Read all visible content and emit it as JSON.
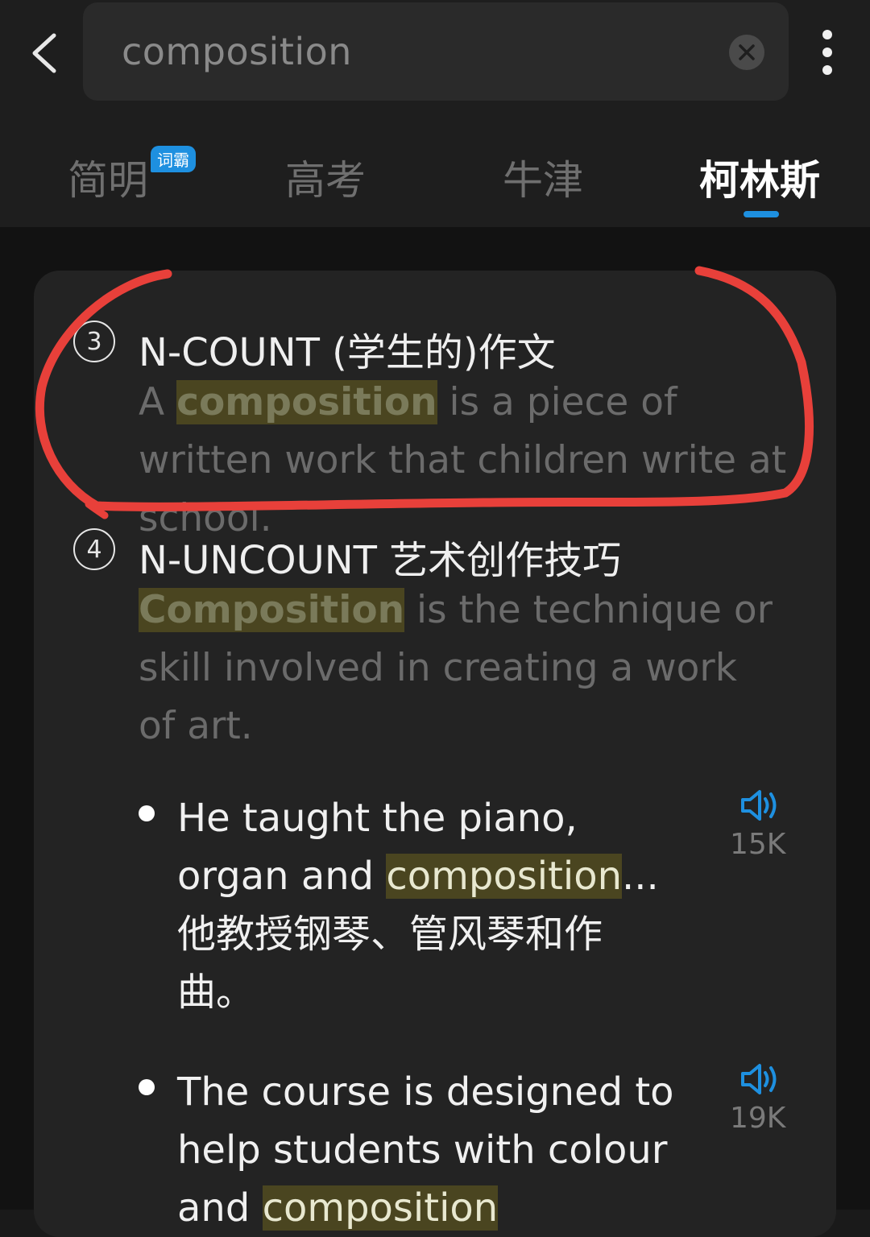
{
  "search": {
    "query": "composition"
  },
  "tabs": [
    {
      "label": "简明",
      "badge": "词霸"
    },
    {
      "label": "高考"
    },
    {
      "label": "牛津"
    },
    {
      "label": "柯林斯"
    }
  ],
  "senses": [
    {
      "number": "3",
      "head": "N-COUNT (学生的)作文",
      "def_pre": "A ",
      "def_hl": "composition",
      "def_post": " is a piece of written work that children write at school."
    },
    {
      "number": "4",
      "head": "N-UNCOUNT 艺术创作技巧",
      "def_hl": "Composition",
      "def_post": " is the technique or skill involved in creating a work of art."
    }
  ],
  "examples": [
    {
      "en_pre": "He taught the piano, organ and ",
      "en_hl": "composition",
      "en_post": "...",
      "zh": "他教授钢琴、管风琴和作曲。",
      "count": "15K"
    },
    {
      "en_pre": "The course is designed to help students with colour and ",
      "en_hl": "composition",
      "en_post": "",
      "count": "19K"
    }
  ],
  "colors": {
    "accent": "#1e90e0",
    "highlight": "#4a4520",
    "annotation": "#e8403a"
  }
}
